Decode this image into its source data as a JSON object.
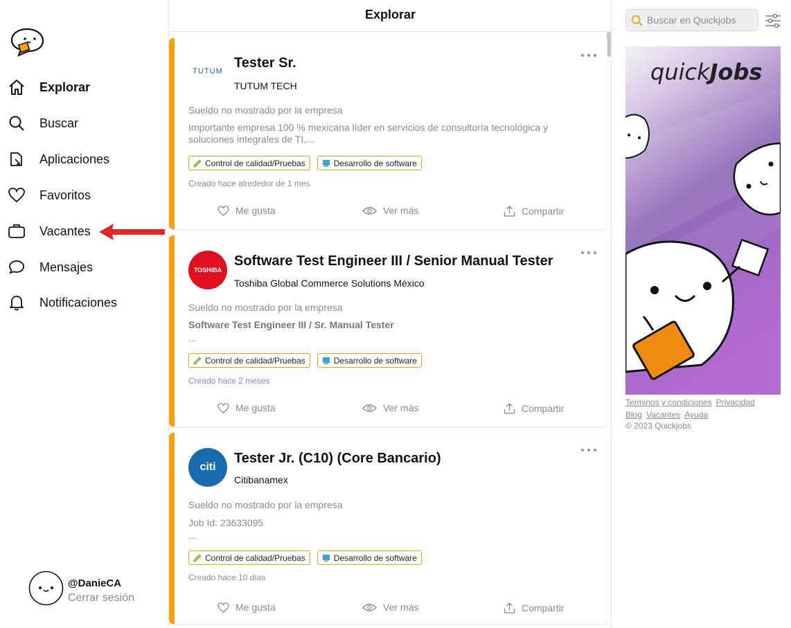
{
  "sidebar": {
    "items": [
      {
        "label": "Explorar",
        "icon": "home-icon",
        "active": true
      },
      {
        "label": "Buscar",
        "icon": "search-icon",
        "active": false
      },
      {
        "label": "Aplicaciones",
        "icon": "applications-icon",
        "active": false
      },
      {
        "label": "Favoritos",
        "icon": "heart-icon",
        "active": false
      },
      {
        "label": "Vacantes",
        "icon": "briefcase-icon",
        "active": false
      },
      {
        "label": "Mensajes",
        "icon": "chat-bubble-icon",
        "active": false
      },
      {
        "label": "Notificaciones",
        "icon": "bell-icon",
        "active": false
      }
    ],
    "user": {
      "handle": "@DanieCA",
      "logout_label": "Cerrar sesión"
    }
  },
  "feed": {
    "title": "Explorar",
    "cards": [
      {
        "title": "Tester Sr.",
        "company": "TUTUM TECH",
        "logo_text": "TUTUM",
        "salary": "Sueldo no mostrado por la empresa",
        "desc_line1": "Importante empresa 100 % mexicana líder en servicios de consultoría tecnológica y",
        "desc_line2": "soluciones integrales de TI,...",
        "tags": [
          "Control de calidad/Pruebas",
          "Desarrollo de software"
        ],
        "created": "Creado hace alrededor de 1 mes"
      },
      {
        "title": "Software Test Engineer III / Senior Manual Tester",
        "company": "Toshiba Global Commerce Solutions México",
        "logo_text": "TOSHIBA",
        "salary": "Sueldo no mostrado por la empresa",
        "desc_line1": "Software Test Engineer III / Sr. Manual Tester",
        "desc_line2": "...",
        "tags": [
          "Control de calidad/Pruebas",
          "Desarrollo de software"
        ],
        "created": "Creado hace 2 meses"
      },
      {
        "title": "Tester Jr. (C10) (Core Bancario)",
        "company": "Citibanamex",
        "logo_text": "citi",
        "salary": "Sueldo no mostrado por la empresa",
        "desc_line1": "Job Id: 23633095",
        "desc_line2": "...",
        "tags": [
          "Control de calidad/Pruebas",
          "Desarrollo de software"
        ],
        "created": "Creado hace 10 días"
      }
    ],
    "actions": {
      "like": "Me gusta",
      "view": "Ver más",
      "share": "Compartir"
    }
  },
  "right": {
    "search_placeholder": "Buscar en Quickjobs",
    "promo_brand_light": "quick",
    "promo_brand_bold": "Jobs",
    "links_row1": [
      "Terminos y condiciones",
      "Privacidad"
    ],
    "links_row2": [
      "Blog",
      "Vacantes",
      "Ayuda"
    ],
    "copyright": "© 2023 Quickjobs"
  },
  "colors": {
    "accent": "#f4a011",
    "arrow": "#e3262b",
    "promo_top": "#f2f2f2",
    "promo_bottom": "#b36ad3"
  }
}
